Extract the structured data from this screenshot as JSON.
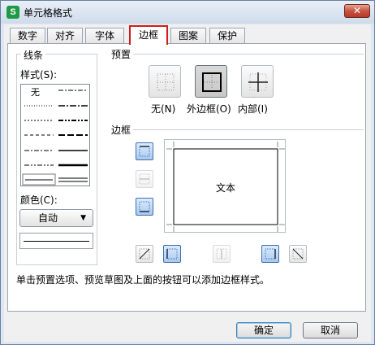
{
  "window": {
    "title": "单元格格式",
    "app_icon": "S",
    "close_label": "✕"
  },
  "tabs": [
    {
      "label": "数字"
    },
    {
      "label": "对齐"
    },
    {
      "label": "字体"
    },
    {
      "label": "边框",
      "active": true
    },
    {
      "label": "图案"
    },
    {
      "label": "保护"
    }
  ],
  "line_group": {
    "title": "线条",
    "style_label": "样式(S):",
    "none_label": "无",
    "color_label": "颜色(C):",
    "color_value": "自动"
  },
  "preset_group": {
    "title": "预置",
    "items": [
      {
        "label": "无(N)",
        "icon": "no-border-icon"
      },
      {
        "label": "外边框(O)",
        "icon": "outline-border-icon"
      },
      {
        "label": "内部(I)",
        "icon": "inside-border-icon"
      }
    ]
  },
  "border_group": {
    "title": "边框",
    "preview_text": "文本"
  },
  "hint": "单击预置选项、预览草图及上面的按钮可以添加边框样式。",
  "buttons": {
    "ok": "确定",
    "cancel": "取消"
  },
  "colors": {
    "active_tab_outline": "#d11b1b",
    "title_gradient_top": "#e9eff8",
    "toggle_on": "#a9c9ef"
  }
}
